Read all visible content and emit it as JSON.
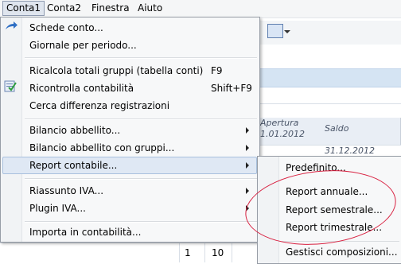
{
  "menubar": {
    "items": [
      {
        "label": "Conta1"
      },
      {
        "label": "Conta2"
      },
      {
        "label": "Finestra"
      },
      {
        "label": "Aiuto"
      }
    ]
  },
  "menu": {
    "items": [
      {
        "label": "Schede conto..."
      },
      {
        "label": "Giornale per periodo..."
      },
      {
        "label": "Ricalcola totali gruppi (tabella conti)",
        "shortcut": "F9"
      },
      {
        "label": "Ricontrolla contabilità",
        "shortcut": "Shift+F9"
      },
      {
        "label": "Cerca differenza registrazioni"
      },
      {
        "label": "Bilancio abbellito..."
      },
      {
        "label": "Bilancio abbellito con gruppi..."
      },
      {
        "label": "Report contabile..."
      },
      {
        "label": "Riassunto IVA..."
      },
      {
        "label": "Plugin IVA..."
      },
      {
        "label": "Importa in contabilità..."
      }
    ]
  },
  "submenu": {
    "items": [
      {
        "label": "Predefinito..."
      },
      {
        "label": "Report annuale..."
      },
      {
        "label": "Report semestrale..."
      },
      {
        "label": "Report trimestrale..."
      },
      {
        "label": "Gestisci composizioni..."
      }
    ]
  },
  "table": {
    "col1_line1": "Apertura",
    "col1_line2": "1.01.2012",
    "col2": "Saldo  31.12.2012",
    "bottom_vals": [
      "1",
      "10"
    ]
  },
  "colors": {
    "highlight": "#dfe8f4",
    "annotation": "#d81f3f"
  }
}
